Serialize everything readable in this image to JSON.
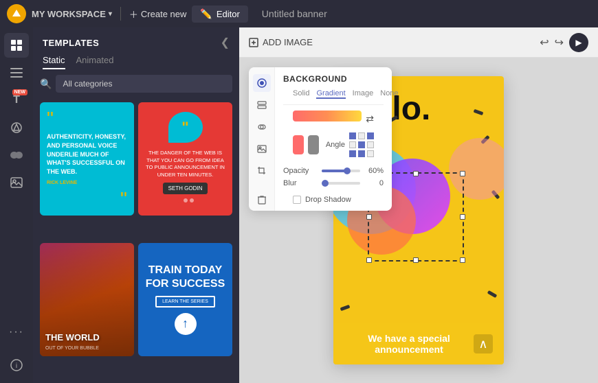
{
  "topbar": {
    "workspace_label": "MY WORKSPACE",
    "create_new_label": "Create new",
    "editor_label": "Editor",
    "title": "Untitled banner"
  },
  "left_icons": [
    {
      "name": "templates-icon",
      "symbol": "⊞"
    },
    {
      "name": "layers-icon",
      "symbol": "☰"
    },
    {
      "name": "text-icon",
      "symbol": "T",
      "badge": "NEW"
    },
    {
      "name": "elements-icon",
      "symbol": "◇"
    },
    {
      "name": "links-icon",
      "symbol": "🔗"
    },
    {
      "name": "media-icon",
      "symbol": "▣"
    },
    {
      "name": "more-icon",
      "symbol": "···"
    }
  ],
  "templates_panel": {
    "title": "TEMPLATES",
    "tabs": [
      "Static",
      "Animated"
    ],
    "active_tab": "Static",
    "category_placeholder": "All categories",
    "templates": [
      {
        "id": 1,
        "type": "cyan-quote",
        "quote_text": "AUTHENTICITY, HONESTY, AND PERSONAL VOICE UNDERLIE MUCH OF WHAT'S SUCCESSFUL ON THE WEB.",
        "author": "RICK LEVINE"
      },
      {
        "id": 2,
        "type": "red-bubble",
        "text": "THE DANGER OF THE WEB IS THAT YOU CAN GO FROM IDEA TO PUBLIC ANNOUNCEMENT IN UNDER TEN MINUTES.",
        "author": "SETH GODIN",
        "dots": [
          "#e53935",
          "#fff",
          "#fff"
        ]
      },
      {
        "id": 3,
        "type": "orange-world",
        "headline": "THE WORLD",
        "subtext": "OUT OF YOUR BUBBLE"
      },
      {
        "id": 4,
        "type": "blue-train",
        "headline": "TRAIN TODAY FOR SUCCESS",
        "btn_label": "LEARN THE SERIES"
      }
    ]
  },
  "canvas_toolbar": {
    "add_image_label": "ADD IMAGE"
  },
  "bg_panel": {
    "title": "BACKGROUND",
    "tabs": [
      "Solid",
      "Gradient",
      "Image",
      "None"
    ],
    "active_tab": "Gradient",
    "angle_label": "Angle",
    "opacity_label": "Opacity",
    "opacity_value": "60%",
    "opacity_pct": 60,
    "blur_label": "Blur",
    "blur_value": "0",
    "blur_pct": 0,
    "drop_shadow_label": "Drop Shadow"
  },
  "canvas": {
    "hello_text": "hello.",
    "bottom_text": "We have a special announcement"
  }
}
